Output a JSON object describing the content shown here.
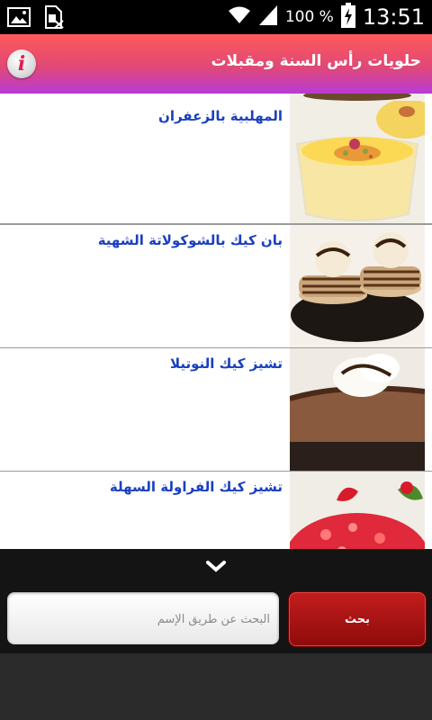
{
  "status_bar": {
    "battery_percent": "100 %",
    "time": "13:51",
    "icons": [
      "gallery-icon",
      "sim-blocked-icon",
      "wifi-icon",
      "signal-icon",
      "battery-charging-icon"
    ]
  },
  "header": {
    "title": "حلويات رأس السنة ومقبلات",
    "info_icon": "info-icon",
    "info_glyph": "i",
    "gradient": [
      "#ff5a5a",
      "#e14875",
      "#b93bd8"
    ]
  },
  "list": {
    "items": [
      {
        "label": "المهلبية بالزعفران",
        "image": "saffron-mahalabia-photo"
      },
      {
        "label": "بان كيك بالشوكولاتة الشهية",
        "image": "chocolate-pancakes-photo"
      },
      {
        "label": "تشيز كيك النوتيلا",
        "image": "nutella-cheesecake-photo"
      },
      {
        "label": "تشيز كيك الفراولة السهلة",
        "image": "strawberry-cheesecake-photo"
      }
    ],
    "label_color": "#1a3fbf"
  },
  "bottom": {
    "collapse_icon": "chevron-down-icon",
    "search_placeholder": "البحث عن طريق الإسم",
    "search_button_label": "بحث",
    "search_button_color": "#b01414"
  }
}
